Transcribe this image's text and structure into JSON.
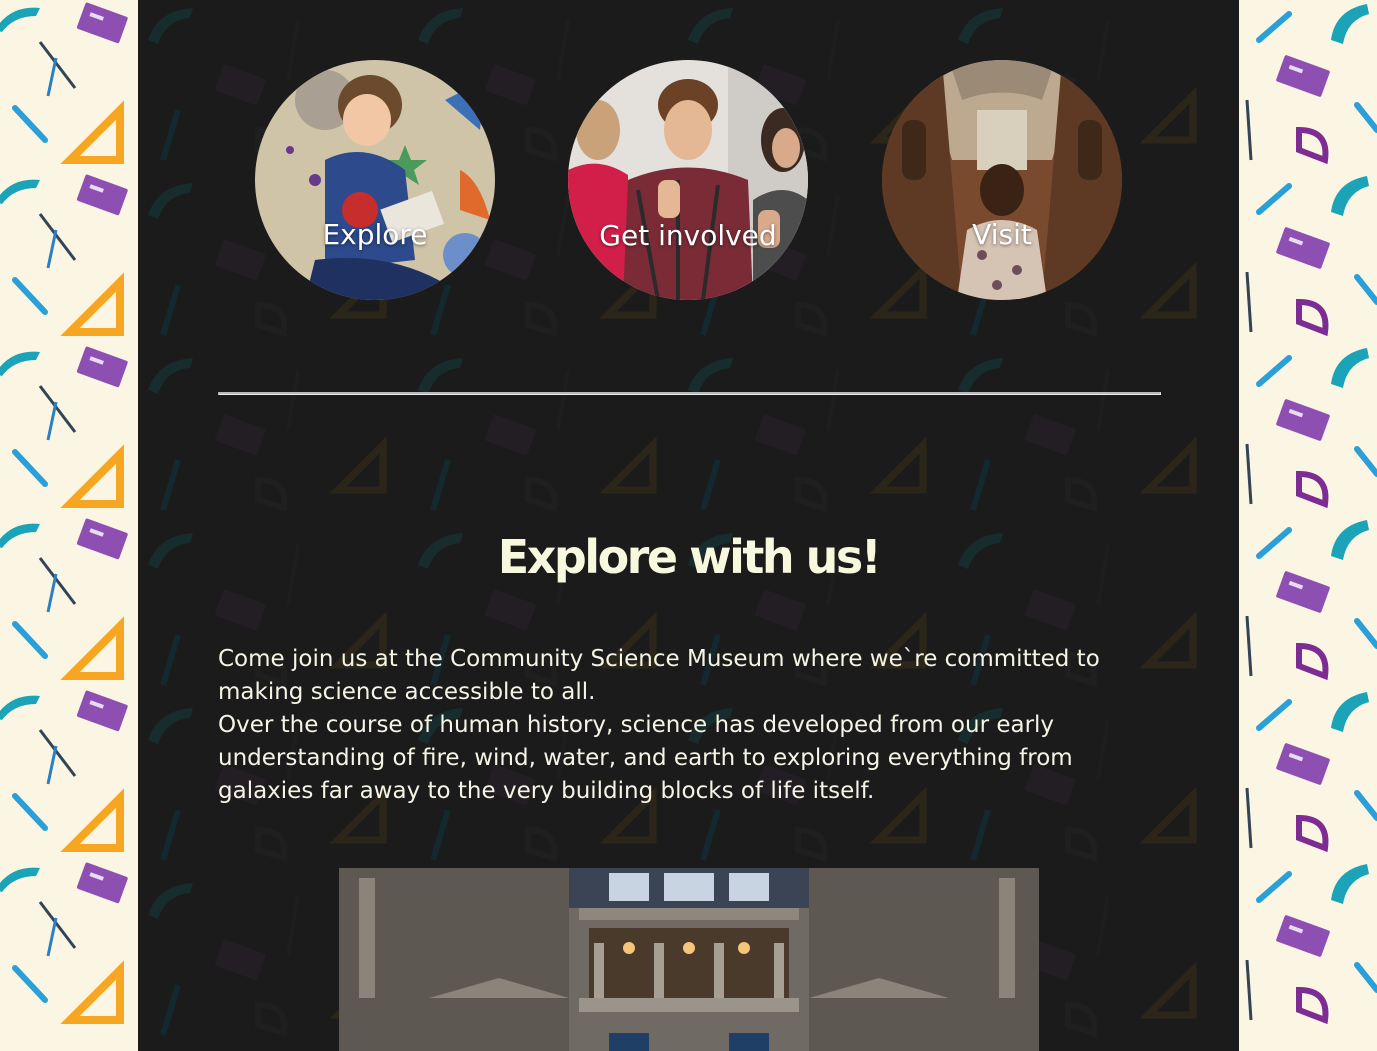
{
  "nav_circles": [
    {
      "label": "Explore",
      "image": "child reading book on space-themed rug"
    },
    {
      "label": "Get involved",
      "image": "group of young people giving thumbs up"
    },
    {
      "label": "Visit",
      "image": "person walking through historic arcade"
    }
  ],
  "section": {
    "heading": "Explore with us!",
    "paragraph_1": "Come join us at the Community Science Museum where we`re committed to making science accessible to all.",
    "paragraph_2": "Over the course of human history, science has developed from our early understanding of fire, wind, water, and earth to exploring everything from galaxies far away to the very building blocks of life itself."
  },
  "colors": {
    "page_bg": "#1b1b1b",
    "side_bg": "#fbf6e4",
    "heading": "#f7f8dd",
    "text": "#f6f4e4",
    "divider": "#b9b9b9"
  }
}
